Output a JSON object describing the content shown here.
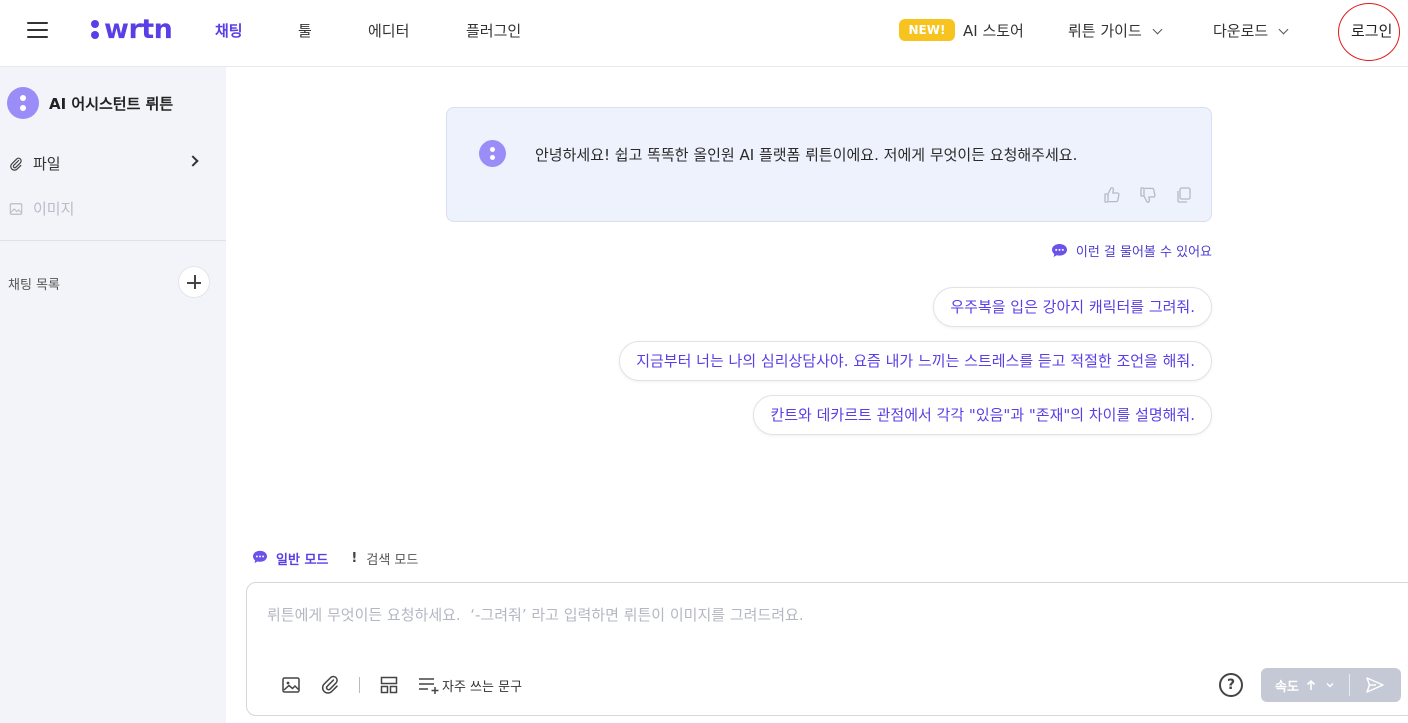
{
  "header": {
    "logo_text": "wrtn",
    "nav": [
      "채팅",
      "툴",
      "에디터",
      "플러그인"
    ],
    "new_badge": "NEW!",
    "store_label": "AI 스토어",
    "guide_label": "뤼튼 가이드",
    "download_label": "다운로드",
    "login_label": "로그인"
  },
  "sidebar": {
    "title": "AI 어시스턴트 뤼튼",
    "file_label": "파일",
    "image_label": "이미지",
    "chat_list_label": "채팅 목록"
  },
  "main": {
    "greeting": "안녕하세요! 쉽고 똑똑한 올인원 AI 플랫폼 뤼튼이에요. 저에게 무엇이든 요청해주세요.",
    "suggest_hint": "이런 걸 물어볼 수 있어요",
    "suggestions": [
      "우주복을 입은 강아지 캐릭터를 그려줘.",
      "지금부터 너는 나의 심리상담사야. 요즘 내가 느끼는 스트레스를 듣고 적절한 조언을 해줘.",
      "칸트와 데카르트 관점에서 각각 \"있음\"과 \"존재\"의 차이를 설명해줘."
    ]
  },
  "modes": {
    "normal": "일반 모드",
    "search": "검색 모드"
  },
  "composer": {
    "placeholder": "뤼튼에게 무엇이든 요청하세요.  ‘-그려줘’ 라고 입력하면 뤼튼이 이미지를 그려드려요.",
    "phrases_label": "자주 쓰는 문구",
    "help_label": "?",
    "speed_label": "속도"
  },
  "colors": {
    "brand": "#5a3fe6",
    "new_badge": "#f7c31f",
    "sidebar_bg": "#f3f4f9",
    "card_bg": "#eef2fd"
  },
  "icons": [
    "menu-icon",
    "paperclip-icon",
    "image-icon",
    "plus-icon",
    "thumbs-up-icon",
    "thumbs-down-icon",
    "copy-icon",
    "chat-bubble-icon",
    "help-icon",
    "send-icon",
    "layout-icon",
    "list-add-icon"
  ]
}
